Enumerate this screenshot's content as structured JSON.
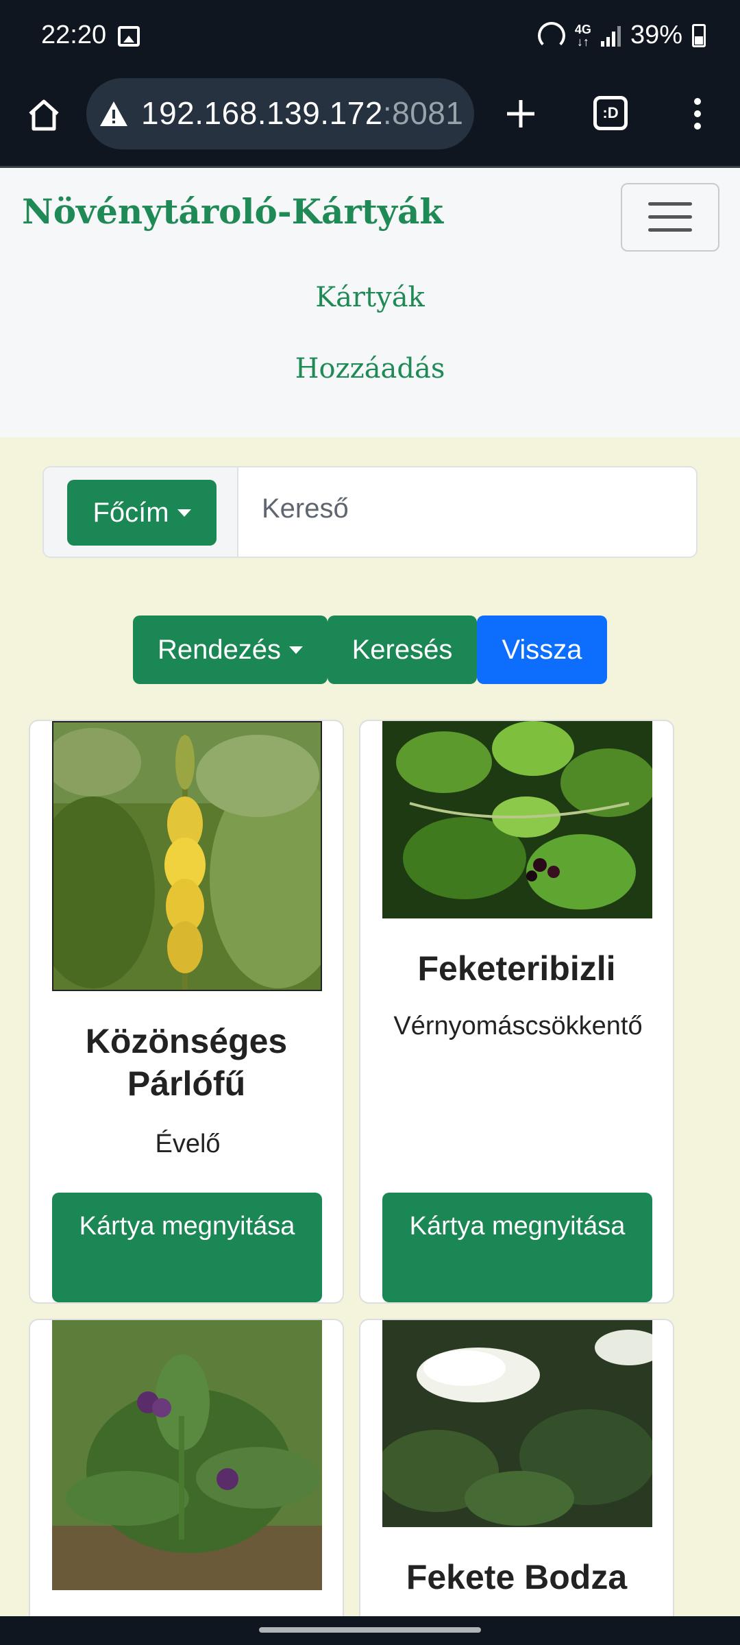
{
  "status_bar": {
    "time": "22:20",
    "network": "4G",
    "battery": "39%",
    "icons": [
      "image-icon",
      "hotspot-icon",
      "signal-icon",
      "battery-icon"
    ]
  },
  "browser": {
    "url_host": "192.168.139.172",
    "url_port": ":8081",
    "tabs_label": ":D",
    "icons": [
      "home-icon",
      "warning-icon",
      "plus-icon",
      "tabs-icon",
      "menu-icon"
    ]
  },
  "navbar": {
    "brand": "Növénytároló-Kártyák",
    "links": [
      "Kártyák",
      "Hozzáadás"
    ]
  },
  "search": {
    "dropdown_label": "Főcím",
    "placeholder": "Kereső"
  },
  "actions": {
    "sort_label": "Rendezés",
    "search_label": "Keresés",
    "back_label": "Vissza"
  },
  "cards": [
    {
      "title": "Közönséges Párlófű",
      "subtitle": "Évelő",
      "button": "Kártya megnyitása",
      "image": "agrimony-flower"
    },
    {
      "title": "Feketeribizli",
      "subtitle": "Vérnyomáscsökkentő",
      "button": "Kártya megnyitása",
      "image": "blackcurrant-leaves"
    },
    {
      "title": "",
      "subtitle": "",
      "button": "",
      "image": "comfrey-plant"
    },
    {
      "title": "Fekete Bodza",
      "subtitle": "",
      "button": "",
      "image": "elderflower"
    }
  ],
  "colors": {
    "primary_green": "#1a8754",
    "brand_green": "#1f8a56",
    "back_blue": "#0d6efd",
    "page_bg": "#f4f4dc",
    "topbar_bg": "#0f1620"
  }
}
